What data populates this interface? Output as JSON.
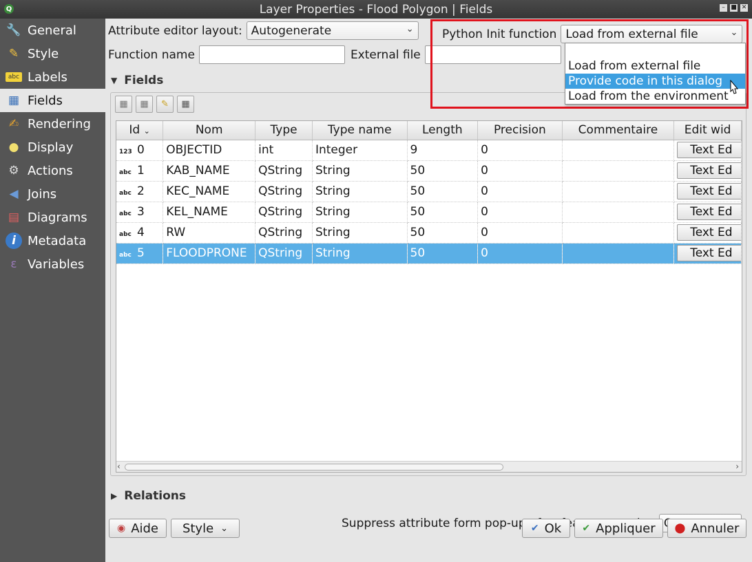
{
  "window": {
    "title": "Layer Properties - Flood Polygon | Fields"
  },
  "sidebar": {
    "items": [
      {
        "label": "General",
        "icon": "wrench-icon"
      },
      {
        "label": "Style",
        "icon": "brush-icon"
      },
      {
        "label": "Labels",
        "icon": "abc-label-icon"
      },
      {
        "label": "Fields",
        "icon": "table-icon"
      },
      {
        "label": "Rendering",
        "icon": "paintbrush-icon"
      },
      {
        "label": "Display",
        "icon": "speech-bubble-icon"
      },
      {
        "label": "Actions",
        "icon": "gear-icon"
      },
      {
        "label": "Joins",
        "icon": "join-arrow-icon"
      },
      {
        "label": "Diagrams",
        "icon": "chart-icon"
      },
      {
        "label": "Metadata",
        "icon": "info-icon"
      },
      {
        "label": "Variables",
        "icon": "variables-icon"
      }
    ],
    "active": "Fields"
  },
  "form": {
    "editor_layout_label": "Attribute editor layout:",
    "editor_layout_value": "Autogenerate",
    "python_init_label": "Python Init function",
    "python_init_value": "Load from external file",
    "function_name_label": "Function name",
    "function_name_value": "",
    "external_file_label": "External file",
    "external_file_value": ""
  },
  "dropdown": {
    "options": [
      "Load from external file",
      "Provide code in this dialog",
      "Load from the environment"
    ],
    "highlighted": "Provide code in this dialog"
  },
  "fields_section": {
    "title": "Fields",
    "columns": [
      "Id",
      "Nom",
      "Type",
      "Type name",
      "Length",
      "Precision",
      "Commentaire",
      "Edit wid"
    ],
    "rows": [
      {
        "type_icon": "123",
        "id": "0",
        "nom": "OBJECTID",
        "type": "int",
        "type_name": "Integer",
        "length": "9",
        "precision": "0",
        "comment": "",
        "edit_widget": "Text Ed"
      },
      {
        "type_icon": "abc",
        "id": "1",
        "nom": "KAB_NAME",
        "type": "QString",
        "type_name": "String",
        "length": "50",
        "precision": "0",
        "comment": "",
        "edit_widget": "Text Ed"
      },
      {
        "type_icon": "abc",
        "id": "2",
        "nom": "KEC_NAME",
        "type": "QString",
        "type_name": "String",
        "length": "50",
        "precision": "0",
        "comment": "",
        "edit_widget": "Text Ed"
      },
      {
        "type_icon": "abc",
        "id": "3",
        "nom": "KEL_NAME",
        "type": "QString",
        "type_name": "String",
        "length": "50",
        "precision": "0",
        "comment": "",
        "edit_widget": "Text Ed"
      },
      {
        "type_icon": "abc",
        "id": "4",
        "nom": "RW",
        "type": "QString",
        "type_name": "String",
        "length": "50",
        "precision": "0",
        "comment": "",
        "edit_widget": "Text Ed"
      },
      {
        "type_icon": "abc",
        "id": "5",
        "nom": "FLOODPRONE",
        "type": "QString",
        "type_name": "String",
        "length": "50",
        "precision": "0",
        "comment": "",
        "edit_widget": "Text Ed"
      }
    ],
    "selected_row": 5
  },
  "relations_section": {
    "title": "Relations"
  },
  "suppress": {
    "label": "Suppress attribute form pop-up after feature creation",
    "value": "On"
  },
  "buttons": {
    "help": "Aide",
    "style": "Style",
    "ok": "Ok",
    "apply": "Appliquer",
    "cancel": "Annuler"
  },
  "colors": {
    "selection": "#5aafe6",
    "highlight": "#3c9fe0",
    "annotation_frame": "#e0121c",
    "sidebar_bg": "#555555"
  }
}
